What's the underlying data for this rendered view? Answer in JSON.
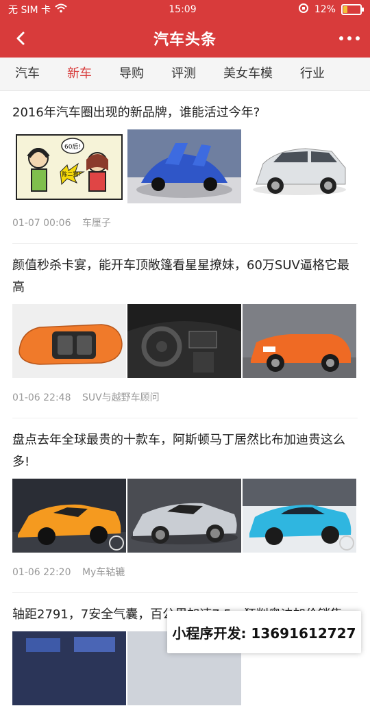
{
  "status": {
    "carrier": "无 SIM 卡",
    "time": "15:09",
    "battery": "12%",
    "icons": [
      "wifi-icon",
      "lock-rotation-icon",
      "battery-icon"
    ]
  },
  "nav": {
    "title": "汽车头条",
    "back_icon": "back-chevron-icon",
    "more_icon": "more-dots-icon"
  },
  "tabs": [
    {
      "label": "汽车"
    },
    {
      "label": "新车"
    },
    {
      "label": "导购"
    },
    {
      "label": "评测"
    },
    {
      "label": "美女车模"
    },
    {
      "label": "行业"
    }
  ],
  "colors": {
    "brand_red": "#d83b3b",
    "active_tab": "#d83b3b",
    "meta_gray": "#999999"
  },
  "articles": [
    {
      "headline": "2016年汽车圈出现的新品牌，谁能活过今年?",
      "time": "01-07 00:06",
      "source": "车厘子"
    },
    {
      "headline": "颜值秒杀卡宴，能开车顶敞篷看星星撩妹，60万SUV逼格它最高",
      "time": "01-06 22:48",
      "source": "SUV与越野车顾问"
    },
    {
      "headline": "盘点去年全球最贵的十款车，阿斯顿马丁居然比布加迪贵这么多!",
      "time": "01-06 22:20",
      "source": "My车轱辘"
    },
    {
      "headline": "轴距2791，7安全气囊，百公里加速7.5，狂削奥迪加价销售"
    }
  ],
  "comic": {
    "bubble1": "60后!",
    "bubble2": "陈二狗!"
  },
  "overlay": {
    "text": "小程序开发: 13691612727"
  }
}
